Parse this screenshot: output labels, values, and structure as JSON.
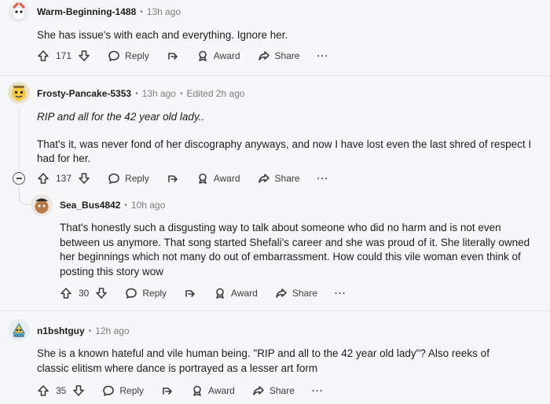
{
  "comments": [
    {
      "username": "Warm-Beginning-1488",
      "time": "13h ago",
      "edited": "",
      "paragraphs": [
        "She has issue's with each and everything. Ignore her."
      ],
      "votes": "171",
      "reply": "Reply",
      "award": "Award",
      "share": "Share"
    },
    {
      "username": "Frosty-Pancake-5353",
      "time": "13h ago",
      "edited": "Edited 2h ago",
      "paragraphs": [
        "RIP and all for the 42 year old lady..",
        "That's it, was never fond of her discography anyways, and now I have lost even the last shred of respect I had for her."
      ],
      "votes": "137",
      "reply": "Reply",
      "award": "Award",
      "share": "Share"
    },
    {
      "username": "Sea_Bus4842",
      "time": "10h ago",
      "edited": "",
      "paragraphs": [
        "That's honestly such a disgusting way to talk about someone who did no harm and is not even between us anymore. That song started Shefali's career and she was proud of it. She literally owned her beginnings which not many do out of embarrassment. How could this vile woman even think of posting this story wow"
      ],
      "votes": "30",
      "reply": "Reply",
      "award": "Award",
      "share": "Share"
    },
    {
      "username": "n1bshtguy",
      "time": "12h ago",
      "edited": "",
      "paragraphs": [
        "She is a known hateful and vile human being. \"RIP and all to the 42 year old lady\"? Also reeks of classic elitism where dance is portrayed as a lesser art form"
      ],
      "votes": "35",
      "reply": "Reply",
      "award": "Award",
      "share": "Share"
    }
  ],
  "icons": {
    "upvote": "arrow-up-icon",
    "downvote": "arrow-down-icon",
    "reply": "speech-bubble-icon",
    "save": "bookmark-icon",
    "award": "award-icon",
    "share": "share-icon",
    "more": "ellipsis-icon",
    "collapse": "collapse-icon"
  },
  "more_label": "···"
}
